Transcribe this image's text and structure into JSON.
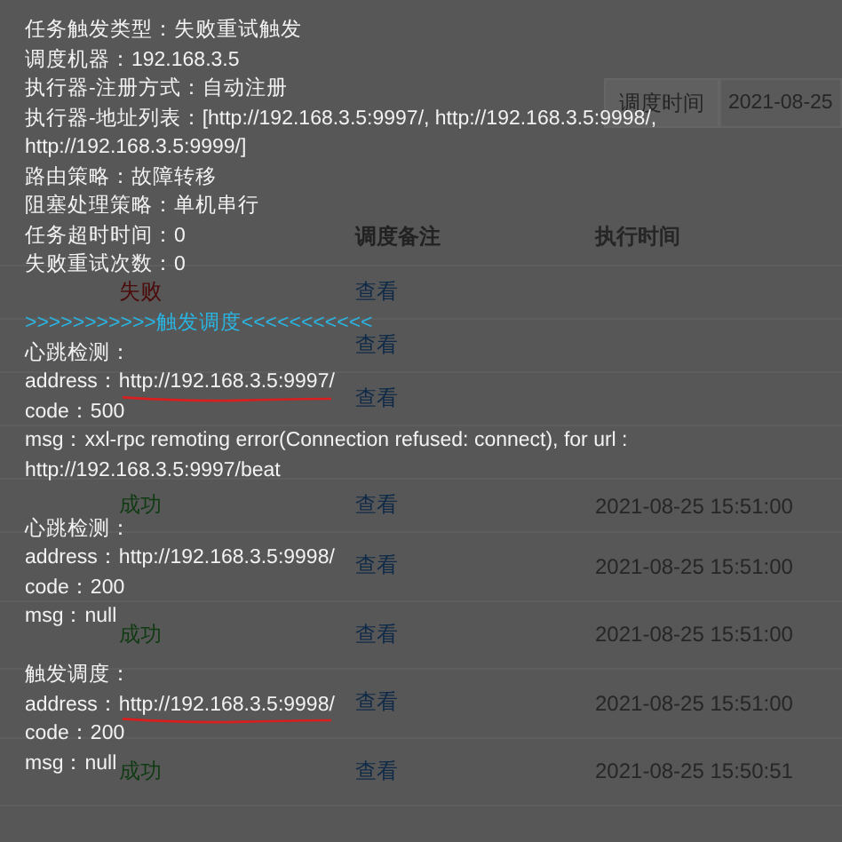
{
  "filter": {
    "time_addon": "调度时间",
    "date_value": "2021-08-25"
  },
  "table": {
    "columns": [
      {
        "text": ""
      },
      {
        "text": "调度备注"
      },
      {
        "text": "执行时间"
      }
    ],
    "rows": [
      {
        "result": "失败",
        "color": "#4d0a0a",
        "remark": "查看"
      },
      {
        "remark": "查看"
      },
      {
        "remark": "查看"
      },
      {},
      {
        "result": "成功",
        "color": "#0f3a12",
        "remark": "查看",
        "time": "2021-08-25 15:51:00"
      },
      {
        "remark": "查看",
        "time": "2021-08-25 15:51:00"
      },
      {
        "result": "成功",
        "color": "#0f3a12",
        "remark": "查看",
        "time": "2021-08-25 15:51:00"
      },
      {
        "remark": "查看",
        "time": "2021-08-25 15:51:00"
      },
      {
        "result": "成功",
        "color": "#0f3a12",
        "remark": "查看",
        "time": "2021-08-25 15:50:51"
      }
    ]
  },
  "log": {
    "sections": [
      {
        "lines": [
          {
            "kind": "plain",
            "text": "任务触发类型：失败重试触发"
          },
          {
            "kind": "plain",
            "text": "调度机器：192.168.3.5"
          },
          {
            "kind": "plain",
            "text": "执行器-注册方式：自动注册"
          },
          {
            "kind": "plain",
            "text": "执行器-地址列表：[http://192.168.3.5:9997/, http://192.168.3.5:9998/,"
          },
          {
            "kind": "plain",
            "text": "http://192.168.3.5:9999/]"
          },
          {
            "kind": "plain",
            "text": "路由策略：故障转移"
          },
          {
            "kind": "plain",
            "text": "阻塞处理策略：单机串行"
          },
          {
            "kind": "plain",
            "text": "任务超时时间：0"
          },
          {
            "kind": "plain",
            "text": "失败重试次数：0"
          }
        ]
      },
      {
        "lines": [
          {
            "kind": "divider",
            "text": ">>>>>>>>>>>触发调度<<<<<<<<<<<"
          },
          {
            "kind": "plain",
            "text": "心跳检测："
          },
          {
            "kind": "address",
            "label": "address：",
            "url": "http://192.168.3.5:9997/",
            "marked": true
          },
          {
            "kind": "plain",
            "text": "code：500"
          },
          {
            "kind": "plain",
            "text": "msg：xxl-rpc remoting error(Connection refused: connect), for url :"
          },
          {
            "kind": "plain",
            "text": "http://192.168.3.5:9997/beat"
          }
        ]
      },
      {
        "lines": [
          {
            "kind": "plain",
            "text": "心跳检测："
          },
          {
            "kind": "address",
            "label": "address：",
            "url": "http://192.168.3.5:9998/"
          },
          {
            "kind": "plain",
            "text": "code：200"
          },
          {
            "kind": "plain",
            "text": "msg：null"
          }
        ]
      },
      {
        "lines": [
          {
            "kind": "plain",
            "text": "触发调度："
          },
          {
            "kind": "address",
            "label": "address：",
            "url": "http://192.168.3.5:9998/",
            "marked": true
          },
          {
            "kind": "plain",
            "text": "code：200"
          },
          {
            "kind": "plain",
            "text": "msg：null"
          }
        ]
      }
    ]
  }
}
